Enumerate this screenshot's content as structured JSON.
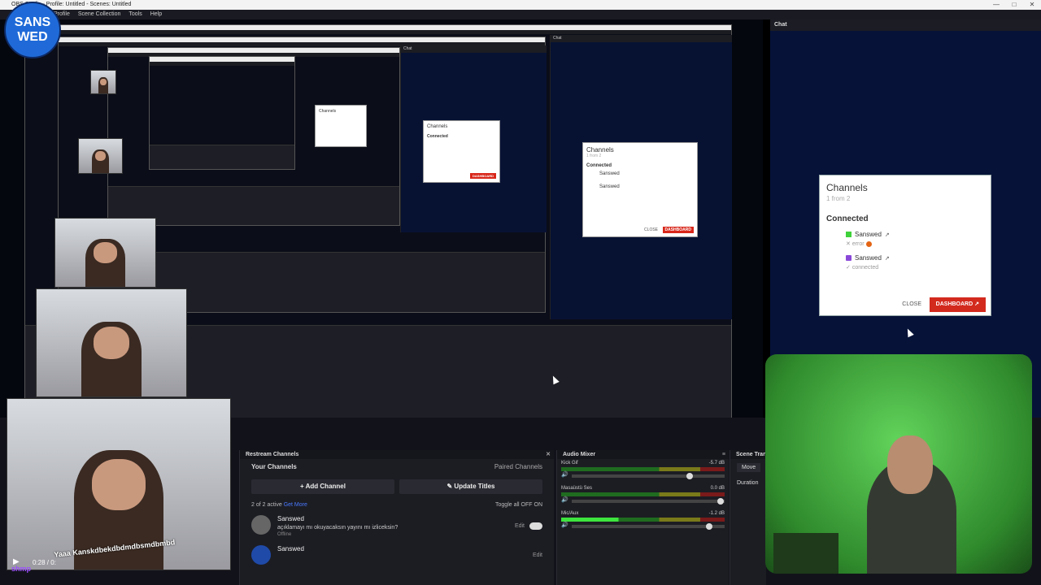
{
  "window": {
    "title": "OBS Studio - Profile: Untitled - Scenes: Untitled"
  },
  "menu": [
    "Profile",
    "Scene Collection",
    "Tools",
    "Help"
  ],
  "logo": {
    "line1": "SANS",
    "line2": "WED"
  },
  "chat_dock": {
    "title": "Chat"
  },
  "channels_dialog": {
    "title": "Channels",
    "subtitle": "1 from 2",
    "connected_label": "Connected",
    "channels": [
      {
        "name": "Sanswed",
        "status": "error"
      },
      {
        "name": "Sanswed",
        "status": "connected"
      }
    ],
    "close": "CLOSE",
    "dashboard": "DASHBOARD"
  },
  "restream": {
    "title": "Restream Channels",
    "your_channels": "Your Channels",
    "paired": "Paired Channels",
    "add_channel": "Add Channel",
    "update_titles": "Update Titles",
    "active": "2 of 2 active",
    "learn_more": "Get More",
    "toggle_all": "Toggle all",
    "off": "OFF",
    "on": "ON",
    "items": [
      {
        "name": "Sanswed",
        "message": "açıklamayı mı okuyacaksın yayını mı izliceksin?",
        "status": "Offline",
        "edit": "Edit"
      },
      {
        "name": "Sanswed",
        "message": "",
        "status": "",
        "edit": "Edit"
      }
    ]
  },
  "mixer": {
    "title": "Audio Mixer",
    "tracks": [
      {
        "name": "Kick Gif",
        "db": "-5.7 dB",
        "level": 0.62
      },
      {
        "name": "Masaüstü Ses",
        "db": "0.0 dB",
        "level": 0.0
      },
      {
        "name": "Mic/Aux",
        "db": "-1.2 dB",
        "level": 0.35
      }
    ]
  },
  "scene_transitions": {
    "title": "Scene Transitions",
    "transition": "Move",
    "duration_label": "Duration"
  },
  "player": {
    "time": "0:28 / 0:"
  },
  "subtitle": "Yaaa Kanskdbekdbdmdbsmdbmbd",
  "username": "shmp"
}
